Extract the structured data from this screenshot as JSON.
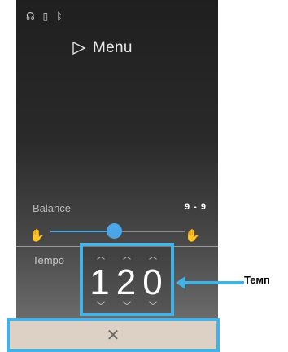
{
  "status_bar": {
    "icons": [
      "headphones-icon",
      "usb-icon",
      "bluetooth-icon"
    ],
    "glyphs": [
      "☊",
      "▯",
      "✱"
    ]
  },
  "menu": {
    "label": "Menu",
    "icon": "play-outline-icon"
  },
  "balance": {
    "label": "Balance",
    "value": "9 - 9",
    "left_icon": "hand-icon",
    "right_icon": "hand-icon",
    "position_fraction": 0.45
  },
  "tempo": {
    "label": "Tempo",
    "value": "120",
    "digit_up_glyph": "^",
    "digit_down_glyph": "v"
  },
  "close": {
    "glyph": "✕",
    "icon": "close-icon"
  },
  "callout": {
    "label": "Temп",
    "text": "Темп"
  },
  "colors": {
    "accent": "#45b2e6",
    "slider": "#4aa6e6",
    "close_bg": "#ddd1c6"
  }
}
